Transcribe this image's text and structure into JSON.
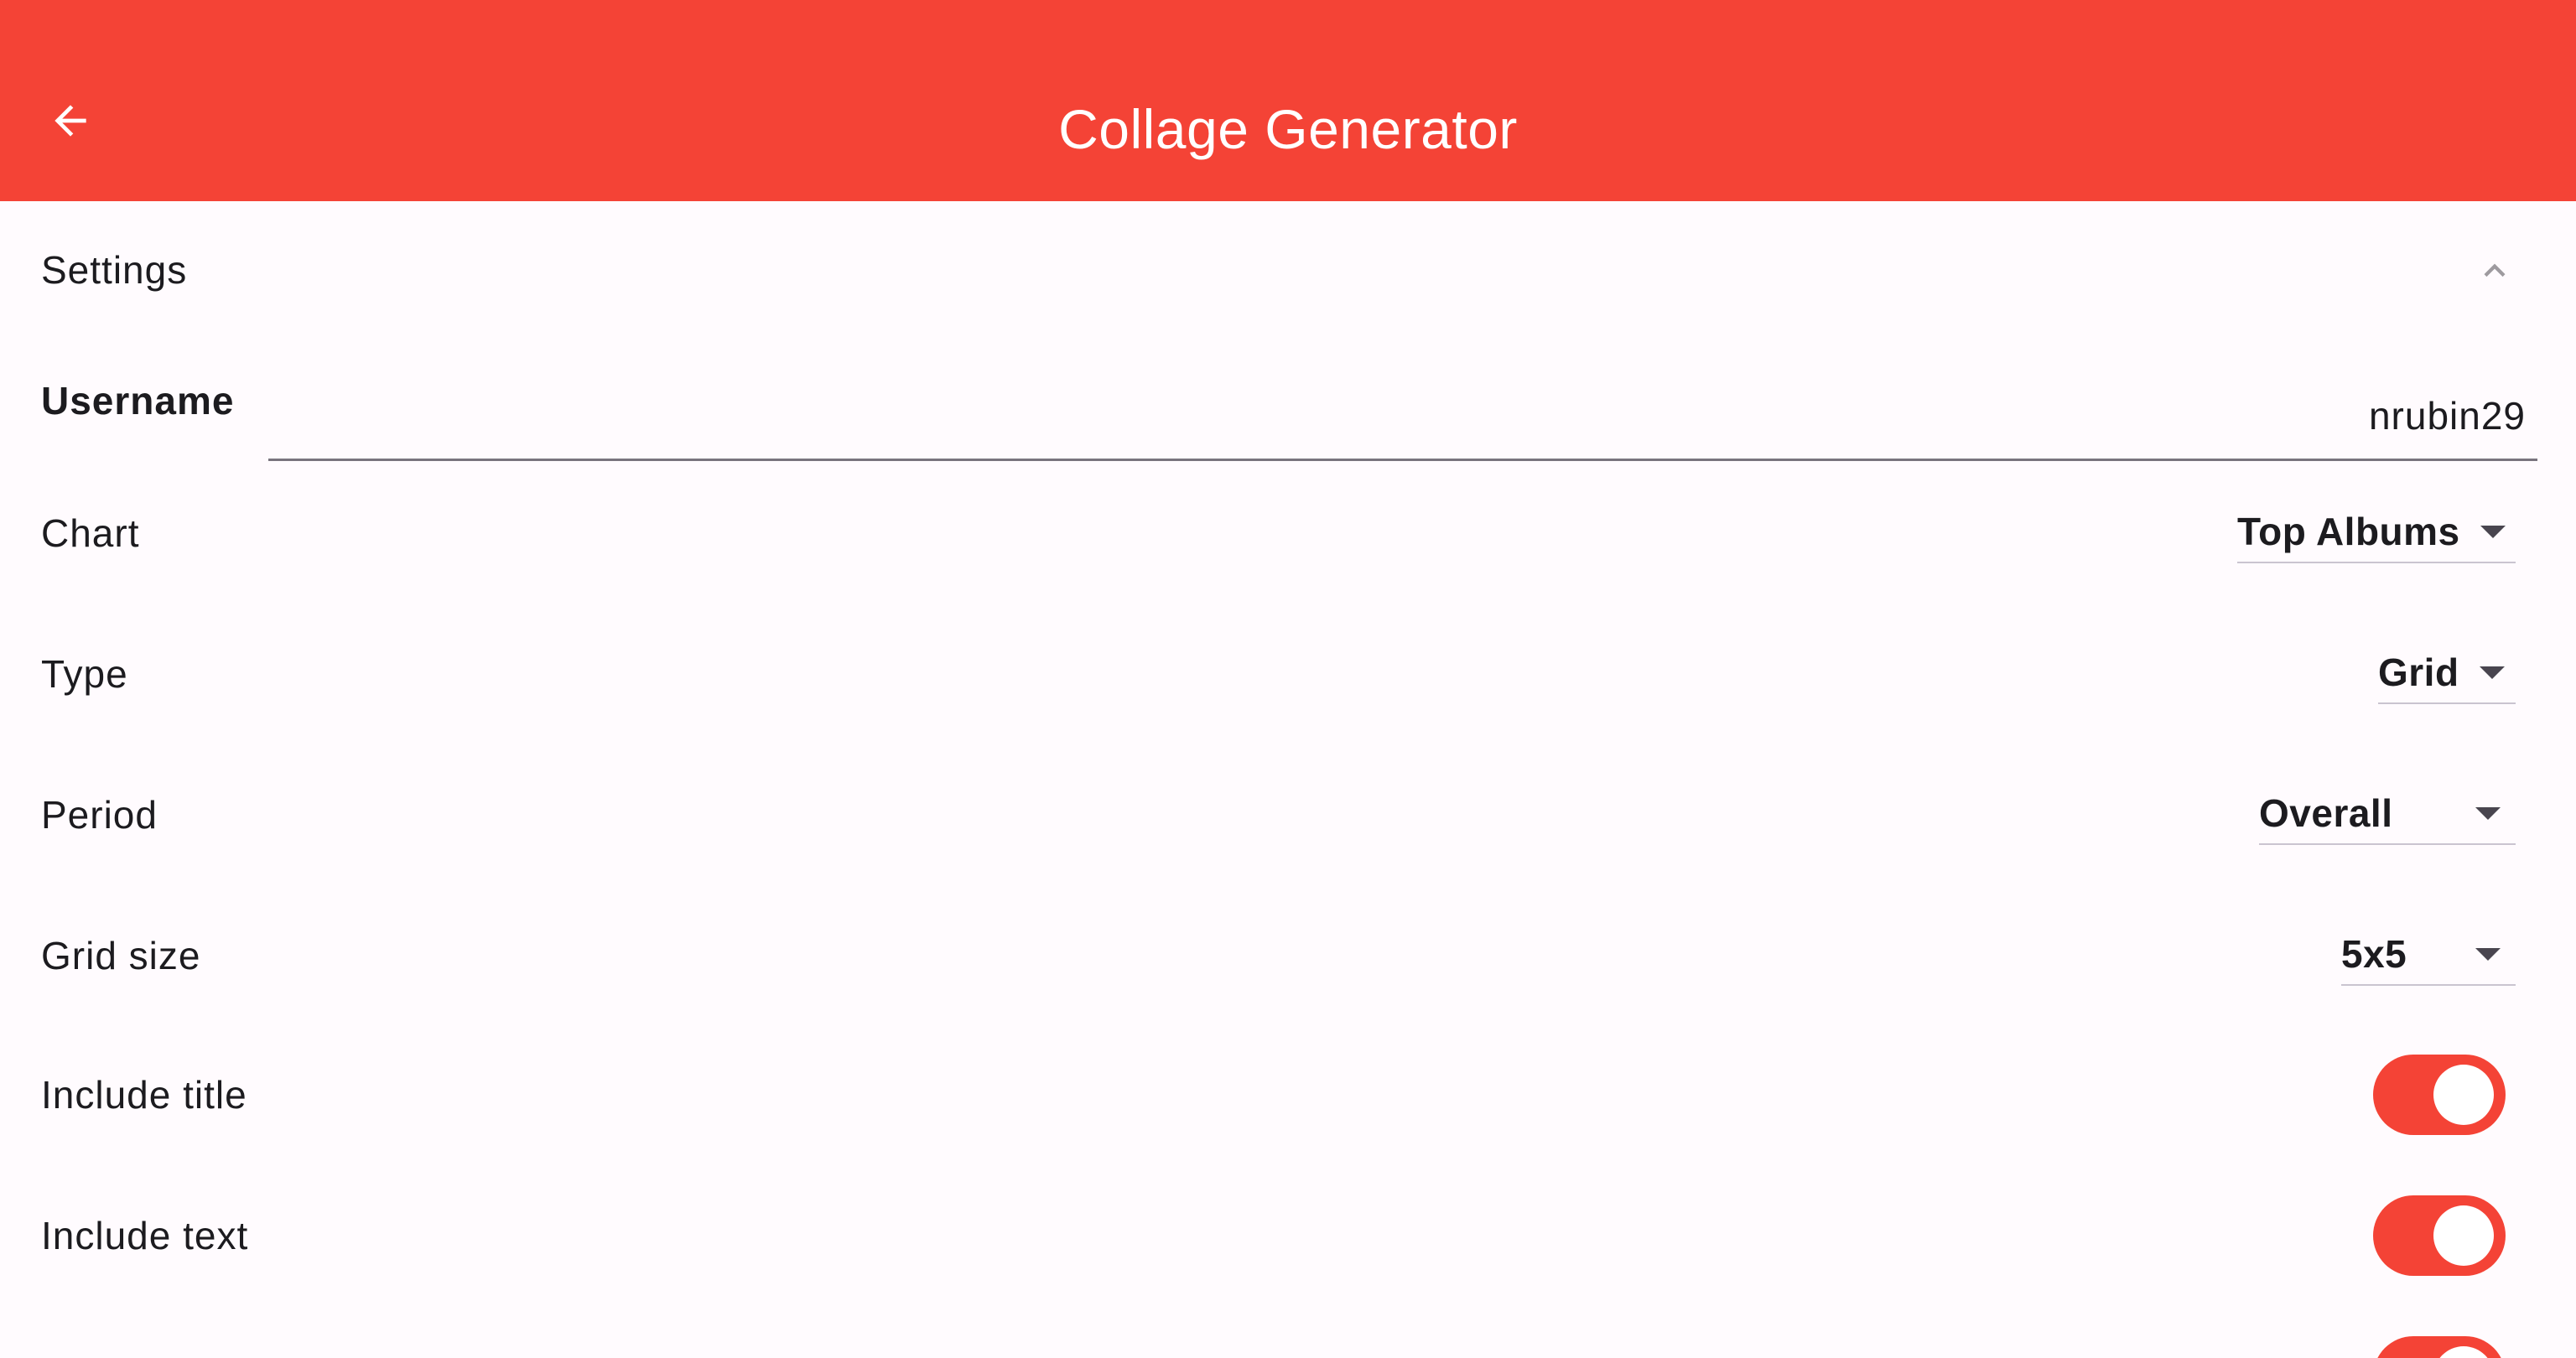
{
  "appbar": {
    "title": "Collage Generator",
    "back_icon": "arrow-back-icon",
    "color": "#f44336"
  },
  "settings": {
    "section_title": "Settings",
    "expanded": true,
    "collapse_icon": "chevron-up-icon",
    "username": {
      "label": "Username",
      "value": "nrubin29"
    },
    "chart": {
      "label": "Chart",
      "value": "Top Albums"
    },
    "type": {
      "label": "Type",
      "value": "Grid"
    },
    "period": {
      "label": "Period",
      "value": "Overall"
    },
    "grid_size": {
      "label": "Grid size",
      "value": "5x5"
    },
    "include_title": {
      "label": "Include title",
      "enabled": true
    },
    "include_text": {
      "label": "Include text",
      "enabled": true
    }
  },
  "accent_color": "#f44336"
}
